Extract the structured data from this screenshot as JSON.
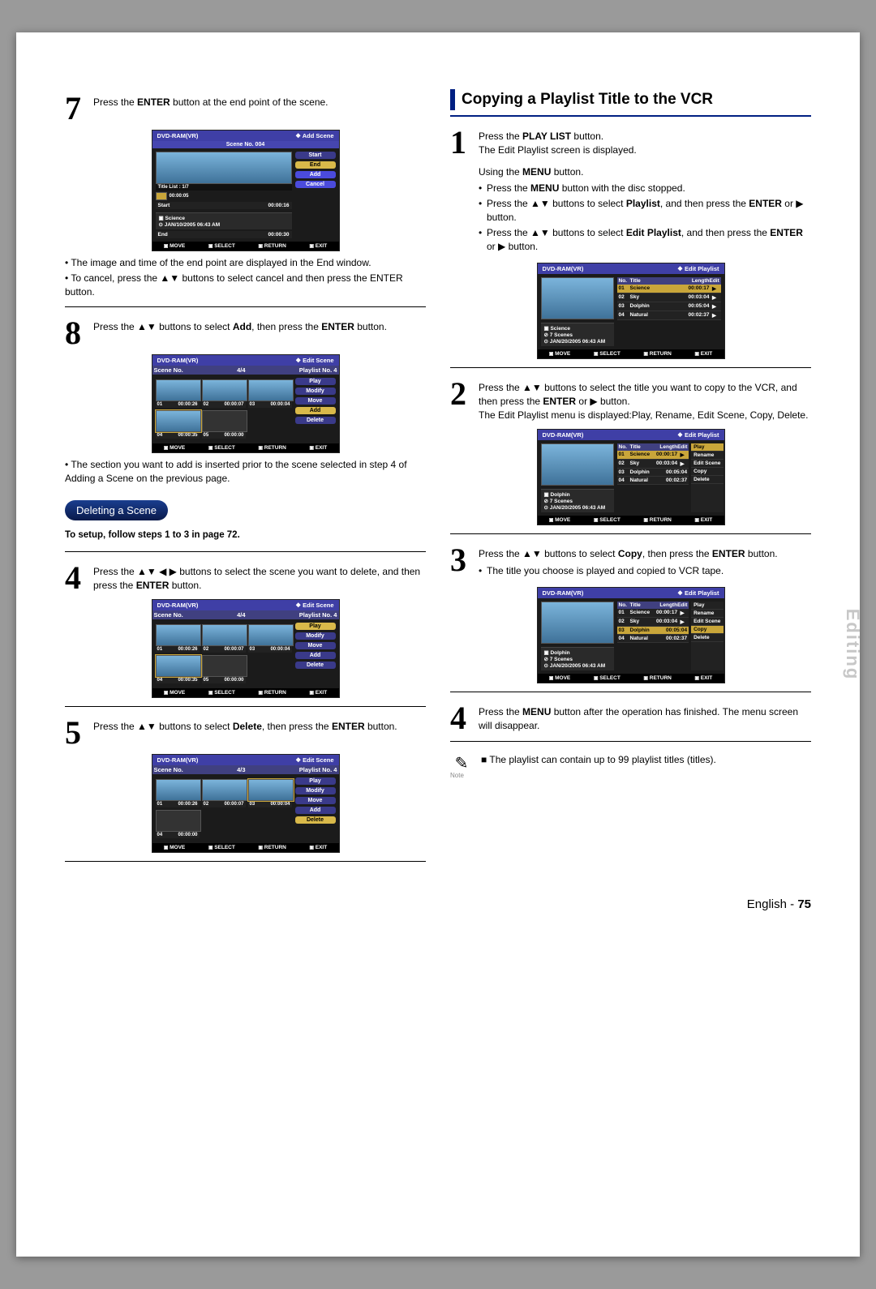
{
  "vtab": "Editing",
  "footer": {
    "lang": "English",
    "sep": "-",
    "page": "75"
  },
  "left": {
    "step7": {
      "num": "7",
      "text_a": "Press the ",
      "text_b": "ENTER",
      "text_c": " button at the end point of the scene.",
      "bullets": [
        "The image and time of the end point are displayed in the End window.",
        "To cancel, press the ▲▼ buttons to select cancel and then press the ENTER button."
      ]
    },
    "osd7": {
      "dev": "DVD-RAM(VR)",
      "mode": "❖  Add Scene",
      "scene": "Scene No. 004",
      "title_list": "Title List : 1/7",
      "timebar": "00:00:05",
      "meta1": "▣ Science",
      "meta2": "⊙ JAN/10/2005 06:43 AM",
      "btns": [
        "Start",
        "End",
        "Add",
        "Cancel"
      ],
      "rows": [
        {
          "l": "Start",
          "v": "00:00:16"
        },
        {
          "l": "End",
          "v": "00:00:30"
        }
      ],
      "foot": [
        "MOVE",
        "SELECT",
        "RETURN",
        "EXIT"
      ]
    },
    "step8": {
      "num": "8",
      "text_a": "Press the ▲▼ buttons to select ",
      "text_b": "Add",
      "text_c": ", then press the ",
      "text_d": "ENTER",
      "text_e": " button.",
      "bullet": "The section you want to add is inserted prior to the scene selected in step 4 of Adding a Scene on the previous page."
    },
    "osd_editscene": {
      "dev": "DVD-RAM(VR)",
      "mode": "❖  Edit Scene",
      "scene_no": "Scene No.",
      "count": "4/4",
      "playlist": "Playlist No.   4",
      "btns": [
        "Play",
        "Modify",
        "Move",
        "Add",
        "Delete"
      ],
      "cells": [
        {
          "n": "01",
          "t": "00:00:26"
        },
        {
          "n": "02",
          "t": "00:00:07"
        },
        {
          "n": "03",
          "t": "00:00:04"
        },
        {
          "n": "04",
          "t": "00:00:35"
        },
        {
          "n": "05",
          "t": "00:00:00"
        }
      ],
      "foot": [
        "MOVE",
        "SELECT",
        "RETURN",
        "EXIT"
      ]
    },
    "deleting": {
      "heading": "Deleting a Scene",
      "setup": "To setup, follow steps 1 to 3 in page 72."
    },
    "step4": {
      "num": "4",
      "text_a": "Press the ▲▼ ◀ ▶ buttons to select the scene you want to delete, and then press the ",
      "text_b": "ENTER",
      "text_c": " button."
    },
    "step5": {
      "num": "5",
      "text_a": "Press the ▲▼ buttons to select ",
      "text_b": "Delete",
      "text_c": ", then press the ",
      "text_d": "ENTER",
      "text_e": " button."
    },
    "osd_step5": {
      "count": "4/3",
      "cells": [
        {
          "n": "01",
          "t": "00:00:26"
        },
        {
          "n": "02",
          "t": "00:00:07"
        },
        {
          "n": "03",
          "t": "00:00:04"
        },
        {
          "n": "04",
          "t": "00:00:00"
        }
      ]
    }
  },
  "right": {
    "section_title": "Copying a Playlist Title to the VCR",
    "step1": {
      "num": "1",
      "line1_a": "Press the ",
      "line1_b": "PLAY LIST",
      "line1_c": " button.",
      "line2": "The Edit Playlist screen is displayed.",
      "menu_title_a": "Using the ",
      "menu_title_b": "MENU",
      "menu_title_c": " button.",
      "b1_a": "Press the ",
      "b1_b": "MENU",
      "b1_c": " button with the disc stopped.",
      "b2_a": "Press the ▲▼ buttons to select ",
      "b2_b": "Playlist",
      "b2_c": ", and then press the ",
      "b2_d": "ENTER",
      "b2_e": " or ▶ button.",
      "b3_a": "Press the ▲▼ buttons to select ",
      "b3_b": "Edit Playlist",
      "b3_c": ", and then press the ",
      "b3_d": "ENTER",
      "b3_e": " or ▶ button."
    },
    "osd_pl": {
      "dev": "DVD-RAM(VR)",
      "mode": "❖  Edit Playlist",
      "head_no": "No.",
      "head_title": "Title",
      "head_len": "Length",
      "head_edit": "Edit",
      "rows": [
        {
          "n": "01",
          "t": "Science",
          "l": "00:00:17",
          "e": "▶"
        },
        {
          "n": "02",
          "t": "Sky",
          "l": "00:03:04",
          "e": "▶"
        },
        {
          "n": "03",
          "t": "Dolphin",
          "l": "00:05:04",
          "e": "▶"
        },
        {
          "n": "04",
          "t": "Natural",
          "l": "00:02:37",
          "e": "▶"
        }
      ],
      "meta1": "▣ Science",
      "meta2": "⊘ 7 Scenes",
      "meta3": "⊙ JAN/20/2005 06:43 AM",
      "foot": [
        "MOVE",
        "SELECT",
        "RETURN",
        "EXIT"
      ]
    },
    "step2": {
      "num": "2",
      "text_a": "Press the ▲▼ buttons to select the title you want to copy to the VCR, and then press the ",
      "text_b": "ENTER",
      "text_c": " or ▶ button.",
      "line2": "The Edit Playlist menu is displayed:Play, Rename, Edit Scene, Copy, Delete."
    },
    "osd_pl2": {
      "meta1": "▣ Dolphin",
      "menu": [
        "Play",
        "Rename",
        "Edit Scene",
        "Copy",
        "Delete"
      ],
      "hl": 0
    },
    "step3": {
      "num": "3",
      "text_a": "Press the ▲▼ buttons to select ",
      "text_b": "Copy",
      "text_c": ", then press the ",
      "text_d": "ENTER",
      "text_e": " button.",
      "bullet": "The title you choose is played and copied to VCR tape."
    },
    "osd_pl3": {
      "hl_row": 2,
      "meta1": "▣ Dolphin",
      "menu_hl": 3
    },
    "step4": {
      "num": "4",
      "text_a": "Press the ",
      "text_b": "MENU",
      "text_c": " button after the operation has finished. The menu screen will disappear."
    },
    "note": {
      "label": "Note",
      "text": "The playlist can contain up to 99 playlist titles (titles)."
    }
  }
}
